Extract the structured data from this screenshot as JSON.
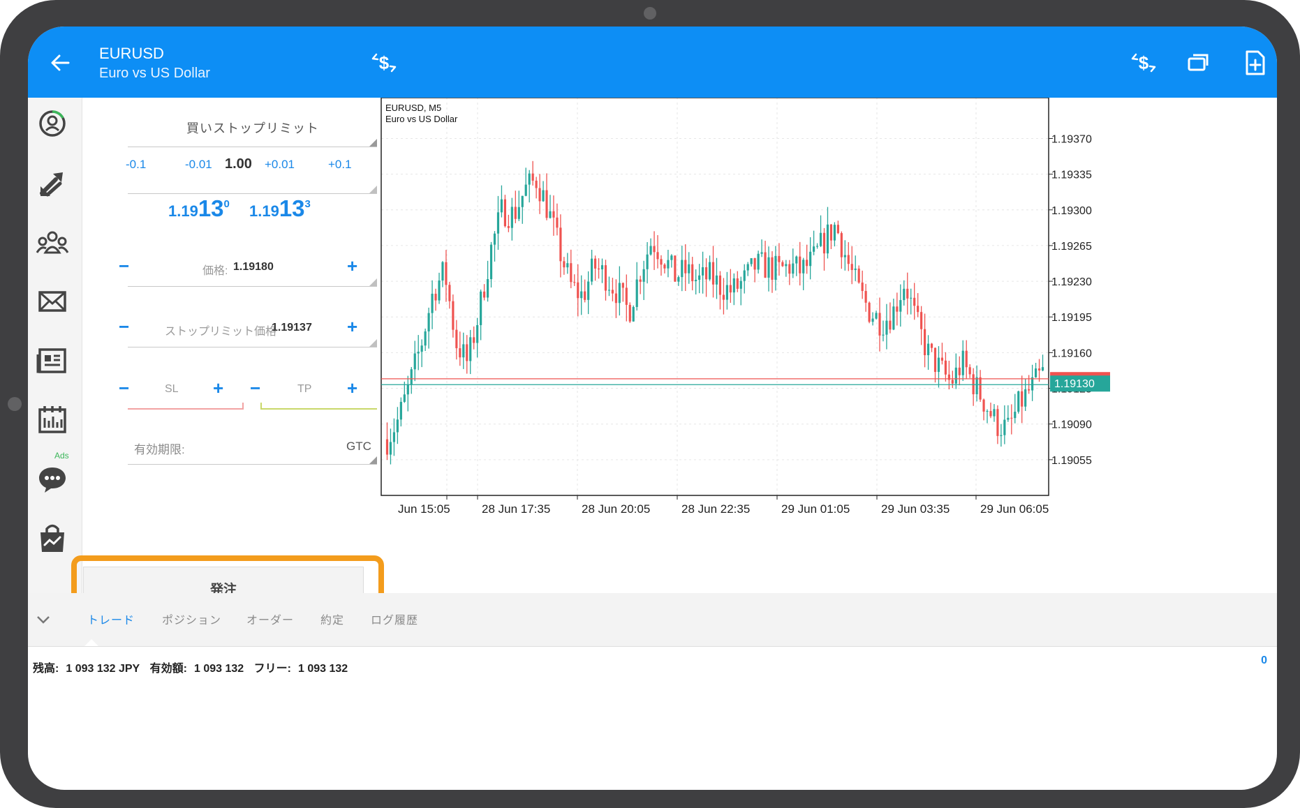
{
  "header": {
    "symbol": "EURUSD",
    "description": "Euro vs US Dollar",
    "icons": [
      "back-arrow-icon",
      "trade-icon",
      "trade-icon",
      "windows-icon",
      "add-document-icon"
    ]
  },
  "nav": {
    "items": [
      "quotes-icon",
      "chart-trade-icon",
      "community-icon",
      "mail-icon",
      "news-icon",
      "calendar-icon",
      "chat-icon",
      "market-icon"
    ],
    "ads_label": "Ads"
  },
  "order": {
    "type": "買いストップリミット",
    "steps": {
      "m01": "-0.1",
      "m001": "-0.01",
      "volume": "1.00",
      "p001": "+0.01",
      "p01": "+0.1"
    },
    "bid": {
      "prefix": "1.19",
      "big": "13",
      "sup": "0"
    },
    "ask": {
      "prefix": "1.19",
      "big": "13",
      "sup": "3"
    },
    "price_label": "価格:",
    "price_value": "1.19180",
    "stoplimit_label": "ストップリミット価格",
    "stoplimit_value": "1.19137",
    "sl_label": "SL",
    "tp_label": "TP",
    "expiry_label": "有効期限:",
    "expiry_value": "GTC",
    "submit_label": "発注",
    "minus": "−",
    "plus": "+"
  },
  "chart_data": {
    "type": "candlestick",
    "title": "EURUSD, M5",
    "subtitle": "Euro vs US Dollar",
    "y_ticks": [
      "1.19370",
      "1.19335",
      "1.19300",
      "1.19265",
      "1.19230",
      "1.19195",
      "1.19160",
      "1.19125",
      "1.19090",
      "1.19055"
    ],
    "x_ticks": [
      "Jun 15:05",
      "28 Jun 17:35",
      "28 Jun 20:05",
      "28 Jun 22:35",
      "29 Jun 01:05",
      "29 Jun 03:35",
      "29 Jun 06:05"
    ],
    "ylim": [
      1.1902,
      1.1941
    ],
    "current_price": "1.19130",
    "ask_price": 1.19133,
    "bid_price": 1.1913,
    "close_path": [
      1.19075,
      1.19095,
      1.1913,
      1.1917,
      1.1922,
      1.1924,
      1.1917,
      1.1915,
      1.192,
      1.1926,
      1.193,
      1.19295,
      1.1932,
      1.1933,
      1.193,
      1.1926,
      1.19225,
      1.19215,
      1.19245,
      1.19235,
      1.1922,
      1.192,
      1.1924,
      1.1927,
      1.19255,
      1.19235,
      1.1924,
      1.1923,
      1.19235,
      1.19225,
      1.1922,
      1.1923,
      1.19245,
      1.19245,
      1.1924,
      1.19245,
      1.1924,
      1.1925,
      1.1927,
      1.19285,
      1.1925,
      1.1922,
      1.192,
      1.1919,
      1.192,
      1.1923,
      1.1919,
      1.1916,
      1.19145,
      1.1913,
      1.1915,
      1.1913,
      1.1911,
      1.1909,
      1.19085,
      1.1911,
      1.19125,
      1.1914
    ]
  },
  "tabs": {
    "items": [
      "トレード",
      "ポジション",
      "オーダー",
      "約定",
      "ログ履歴"
    ],
    "active": "トレード"
  },
  "account": {
    "balance_label": "残高:",
    "balance_value": "1 093 132 JPY",
    "equity_label": "有効額:",
    "equity_value": "1 093 132",
    "free_label": "フリー:",
    "free_value": "1 093 132",
    "count": "0"
  },
  "colors": {
    "appbar": "#0d8ef5",
    "bull": "#26a69a",
    "bear": "#ef5350",
    "accent": "#1a88e8",
    "highlight": "#f39c1c"
  }
}
